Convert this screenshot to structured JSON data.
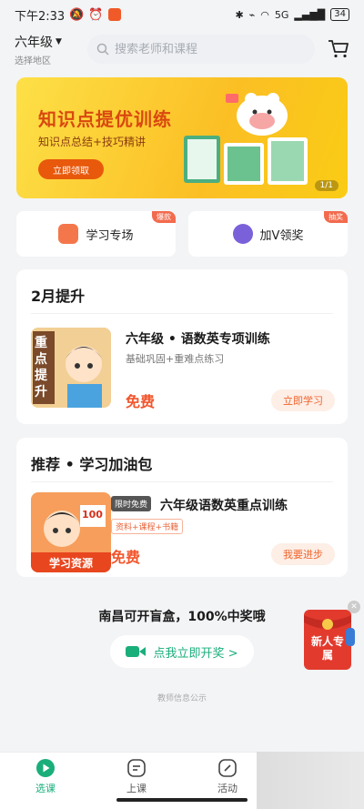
{
  "status": {
    "time": "下午2:33",
    "network": "5G",
    "battery": "34"
  },
  "header": {
    "grade": "六年级",
    "region": "选择地区",
    "search_placeholder": "搜索老师和课程"
  },
  "banner": {
    "title": "知识点提优训练",
    "subtitle": "知识点总结+技巧精讲",
    "button": "立即领取",
    "page": "1/1"
  },
  "quick": [
    {
      "label": "学习专场",
      "tag": "爆款",
      "color": "#f26b4e"
    },
    {
      "label": "加V领奖",
      "tag": "抽奖",
      "color": "#7b61d9"
    }
  ],
  "sections": [
    {
      "title": "2月提升",
      "image_text": "重点提升",
      "course": "六年级 • 语数英专项训练",
      "desc": "基础巩固+重难点练习",
      "price": "免费",
      "action": "立即学习"
    },
    {
      "title": "推荐 • 学习加油包",
      "badge": "限时免费",
      "image_text": "学习资源",
      "image_score": "100",
      "course": "六年级语数英重点训练",
      "tagline": "资料+课程+书籍",
      "price": "免费",
      "action": "我要进步"
    }
  ],
  "promo": {
    "title": "南昌可开盲盒，100%中奖哦",
    "button": "点我立即开奖 >",
    "redpack": "新人专属"
  },
  "teacher_info": "教师信息公示",
  "nav": [
    {
      "label": "选课"
    },
    {
      "label": "上课"
    },
    {
      "label": "活动"
    }
  ],
  "colors": {
    "accent": "#1aae7a",
    "orange": "#f2552c"
  }
}
